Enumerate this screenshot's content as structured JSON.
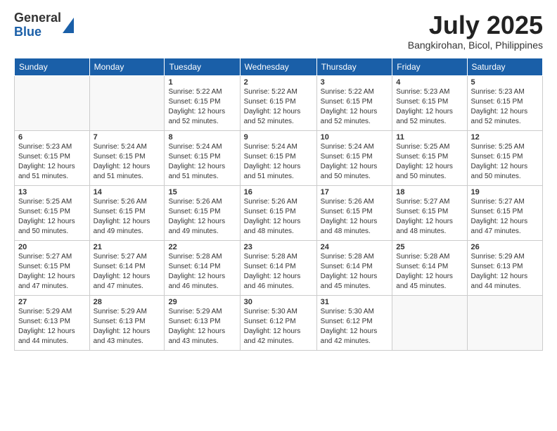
{
  "logo": {
    "general": "General",
    "blue": "Blue"
  },
  "title": "July 2025",
  "subtitle": "Bangkirohan, Bicol, Philippines",
  "days_of_week": [
    "Sunday",
    "Monday",
    "Tuesday",
    "Wednesday",
    "Thursday",
    "Friday",
    "Saturday"
  ],
  "weeks": [
    [
      {
        "day": "",
        "info": ""
      },
      {
        "day": "",
        "info": ""
      },
      {
        "day": "1",
        "info": "Sunrise: 5:22 AM\nSunset: 6:15 PM\nDaylight: 12 hours and 52 minutes."
      },
      {
        "day": "2",
        "info": "Sunrise: 5:22 AM\nSunset: 6:15 PM\nDaylight: 12 hours and 52 minutes."
      },
      {
        "day": "3",
        "info": "Sunrise: 5:22 AM\nSunset: 6:15 PM\nDaylight: 12 hours and 52 minutes."
      },
      {
        "day": "4",
        "info": "Sunrise: 5:23 AM\nSunset: 6:15 PM\nDaylight: 12 hours and 52 minutes."
      },
      {
        "day": "5",
        "info": "Sunrise: 5:23 AM\nSunset: 6:15 PM\nDaylight: 12 hours and 52 minutes."
      }
    ],
    [
      {
        "day": "6",
        "info": "Sunrise: 5:23 AM\nSunset: 6:15 PM\nDaylight: 12 hours and 51 minutes."
      },
      {
        "day": "7",
        "info": "Sunrise: 5:24 AM\nSunset: 6:15 PM\nDaylight: 12 hours and 51 minutes."
      },
      {
        "day": "8",
        "info": "Sunrise: 5:24 AM\nSunset: 6:15 PM\nDaylight: 12 hours and 51 minutes."
      },
      {
        "day": "9",
        "info": "Sunrise: 5:24 AM\nSunset: 6:15 PM\nDaylight: 12 hours and 51 minutes."
      },
      {
        "day": "10",
        "info": "Sunrise: 5:24 AM\nSunset: 6:15 PM\nDaylight: 12 hours and 50 minutes."
      },
      {
        "day": "11",
        "info": "Sunrise: 5:25 AM\nSunset: 6:15 PM\nDaylight: 12 hours and 50 minutes."
      },
      {
        "day": "12",
        "info": "Sunrise: 5:25 AM\nSunset: 6:15 PM\nDaylight: 12 hours and 50 minutes."
      }
    ],
    [
      {
        "day": "13",
        "info": "Sunrise: 5:25 AM\nSunset: 6:15 PM\nDaylight: 12 hours and 50 minutes."
      },
      {
        "day": "14",
        "info": "Sunrise: 5:26 AM\nSunset: 6:15 PM\nDaylight: 12 hours and 49 minutes."
      },
      {
        "day": "15",
        "info": "Sunrise: 5:26 AM\nSunset: 6:15 PM\nDaylight: 12 hours and 49 minutes."
      },
      {
        "day": "16",
        "info": "Sunrise: 5:26 AM\nSunset: 6:15 PM\nDaylight: 12 hours and 48 minutes."
      },
      {
        "day": "17",
        "info": "Sunrise: 5:26 AM\nSunset: 6:15 PM\nDaylight: 12 hours and 48 minutes."
      },
      {
        "day": "18",
        "info": "Sunrise: 5:27 AM\nSunset: 6:15 PM\nDaylight: 12 hours and 48 minutes."
      },
      {
        "day": "19",
        "info": "Sunrise: 5:27 AM\nSunset: 6:15 PM\nDaylight: 12 hours and 47 minutes."
      }
    ],
    [
      {
        "day": "20",
        "info": "Sunrise: 5:27 AM\nSunset: 6:15 PM\nDaylight: 12 hours and 47 minutes."
      },
      {
        "day": "21",
        "info": "Sunrise: 5:27 AM\nSunset: 6:14 PM\nDaylight: 12 hours and 47 minutes."
      },
      {
        "day": "22",
        "info": "Sunrise: 5:28 AM\nSunset: 6:14 PM\nDaylight: 12 hours and 46 minutes."
      },
      {
        "day": "23",
        "info": "Sunrise: 5:28 AM\nSunset: 6:14 PM\nDaylight: 12 hours and 46 minutes."
      },
      {
        "day": "24",
        "info": "Sunrise: 5:28 AM\nSunset: 6:14 PM\nDaylight: 12 hours and 45 minutes."
      },
      {
        "day": "25",
        "info": "Sunrise: 5:28 AM\nSunset: 6:14 PM\nDaylight: 12 hours and 45 minutes."
      },
      {
        "day": "26",
        "info": "Sunrise: 5:29 AM\nSunset: 6:13 PM\nDaylight: 12 hours and 44 minutes."
      }
    ],
    [
      {
        "day": "27",
        "info": "Sunrise: 5:29 AM\nSunset: 6:13 PM\nDaylight: 12 hours and 44 minutes."
      },
      {
        "day": "28",
        "info": "Sunrise: 5:29 AM\nSunset: 6:13 PM\nDaylight: 12 hours and 43 minutes."
      },
      {
        "day": "29",
        "info": "Sunrise: 5:29 AM\nSunset: 6:13 PM\nDaylight: 12 hours and 43 minutes."
      },
      {
        "day": "30",
        "info": "Sunrise: 5:30 AM\nSunset: 6:12 PM\nDaylight: 12 hours and 42 minutes."
      },
      {
        "day": "31",
        "info": "Sunrise: 5:30 AM\nSunset: 6:12 PM\nDaylight: 12 hours and 42 minutes."
      },
      {
        "day": "",
        "info": ""
      },
      {
        "day": "",
        "info": ""
      }
    ]
  ]
}
